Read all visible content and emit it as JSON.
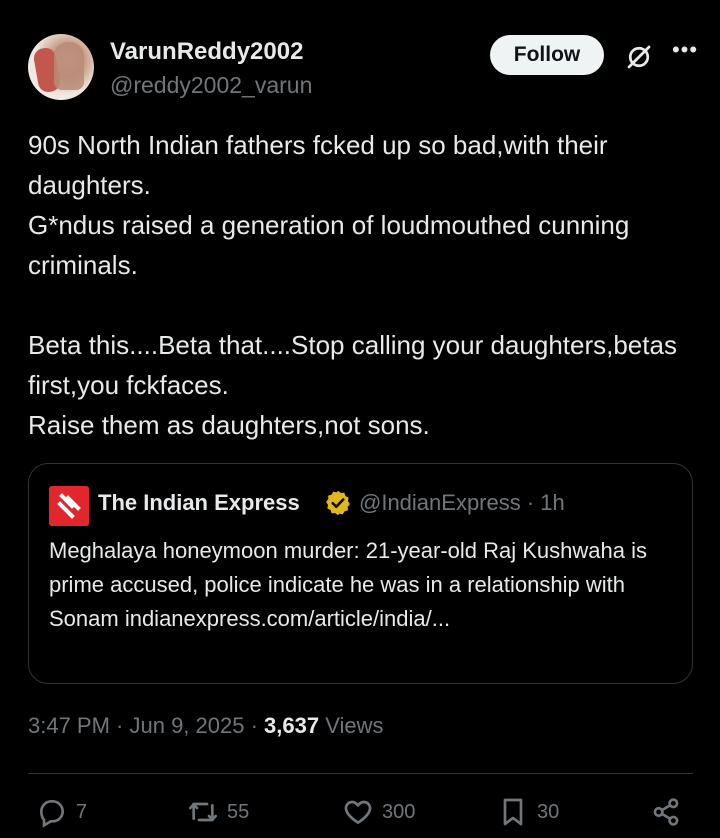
{
  "author": {
    "display_name": "VarunReddy2002",
    "handle": "@reddy2002_varun"
  },
  "header": {
    "follow_label": "Follow",
    "more_icon": "•••"
  },
  "tweet": {
    "text": "90s North Indian fathers fcked up so bad,with their daughters.\nG*ndus raised a generation of loudmouthed cunning criminals.\n\nBeta this....Beta that....Stop calling your daughters,betas first,you fckfaces.\nRaise them as daughters,not sons."
  },
  "quote": {
    "name": "The Indian Express",
    "handle_time": "@IndianExpress · 1h",
    "text": "Meghalaya honeymoon murder: 21-year-old Raj Kushwaha is prime accused, police indicate he was in a relationship with Sonam indianexpress.com/article/india/..."
  },
  "meta": {
    "timestamp": "3:47 PM · Jun 9, 2025 · ",
    "views_count": "3,637",
    "views_label": "Views"
  },
  "actions": {
    "replies": "7",
    "reposts": "55",
    "likes": "300",
    "bookmarks": "30"
  },
  "colors": {
    "background": "#000000",
    "text": "#e7e9ea",
    "muted": "#71767b",
    "border": "#2f3336",
    "verified_gold": "#e2b719",
    "brand_red": "#e1262d"
  },
  "icons": [
    "grok-icon",
    "more-icon",
    "verified-badge-icon",
    "reply-icon",
    "repost-icon",
    "like-icon",
    "bookmark-icon",
    "share-icon"
  ]
}
